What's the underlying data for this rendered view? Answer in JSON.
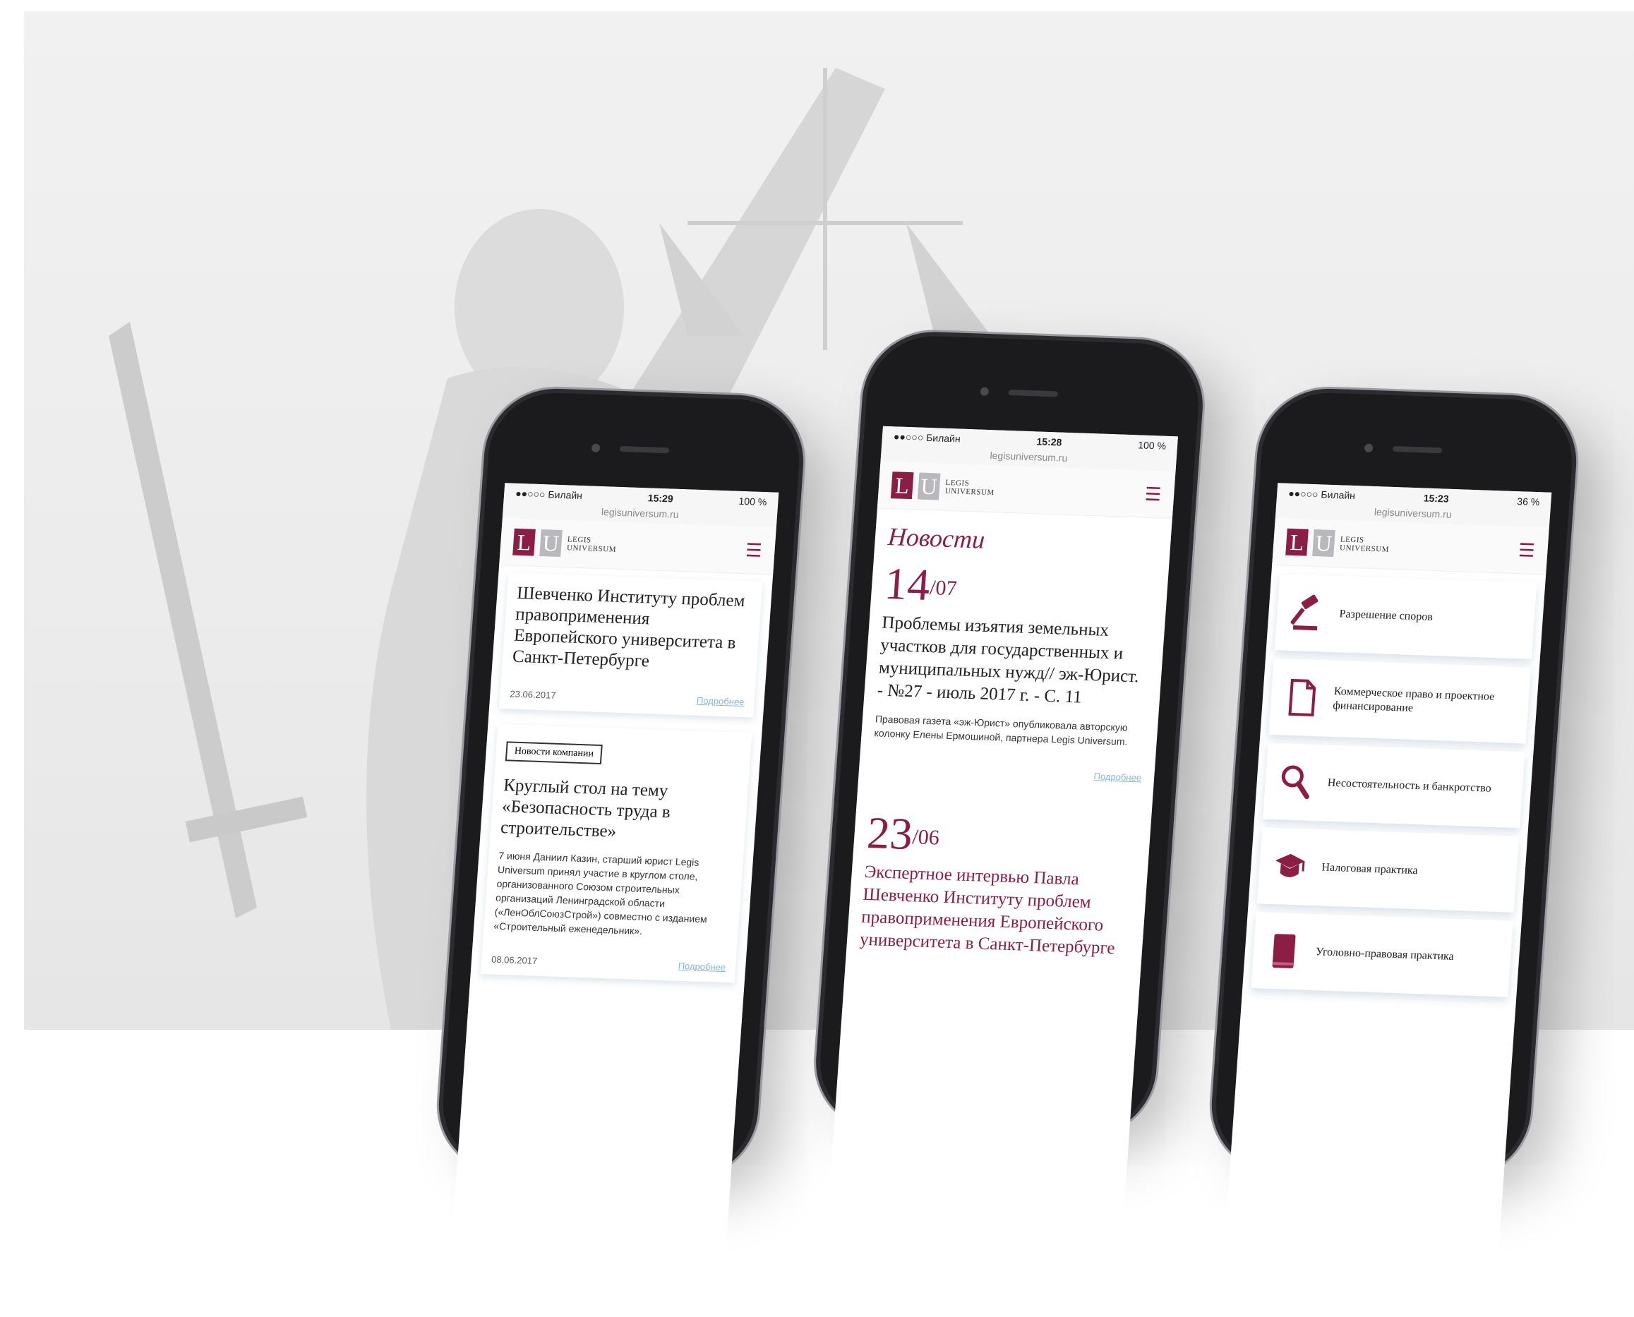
{
  "phone_left": {
    "status": {
      "carrier": "●●○○○ Билайн",
      "time": "15:29",
      "battery": "100 %"
    },
    "url": "legisuniversum.ru",
    "logo": {
      "letter1": "L",
      "letter2": "U",
      "name_line1": "LEGIS",
      "name_line2": "UNIVERSUM"
    },
    "card1": {
      "title": "Шевченко Институту проблем правоприменения Европейского университета в Санкт-Петербурге",
      "date": "23.06.2017",
      "more": "Подробнее"
    },
    "card2": {
      "tag": "Новости компании",
      "title": "Круглый стол на тему «Безопасность труда в строительстве»",
      "lead": "7 июня Даниил Казин, старший юрист Legis Universum принял участие в круглом столе, организованного Союзом строительных организаций Ленинградской области («ЛенОблСоюзСтрой») совместно с изданием «Строительный еженедельник».",
      "date": "08.06.2017",
      "more": "Подробнее"
    }
  },
  "phone_center": {
    "status": {
      "carrier": "●●○○○ Билайн",
      "time": "15:28",
      "battery": "100 %"
    },
    "url": "legisuniversum.ru",
    "logo": {
      "letter1": "L",
      "letter2": "U",
      "name_line1": "LEGIS",
      "name_line2": "UNIVERSUM"
    },
    "section": "Новости",
    "news1": {
      "day": "14",
      "month": "07",
      "title": "Проблемы изъятия земельных участков для государственных и муниципальных нужд// эж-Юрист. - №27 - июль 2017 г. - С. 11",
      "lead": "Правовая газета «эж-Юрист» опубликовала авторскую колонку Елены Ермошиной, партнера Legis Universum.",
      "more": "Подробнее"
    },
    "news2": {
      "day": "23",
      "month": "06",
      "title": "Экспертное интервью Павла Шевченко Институту проблем правоприменения Европейского университета в Санкт-Петербурге"
    }
  },
  "phone_right": {
    "status": {
      "carrier": "●●○○○ Билайн",
      "time": "15:23",
      "battery": "36 %"
    },
    "url": "legisuniversum.ru",
    "logo": {
      "letter1": "L",
      "letter2": "U",
      "name_line1": "LEGIS",
      "name_line2": "UNIVERSUM"
    },
    "practices": [
      {
        "icon": "gavel-icon",
        "label": "Разрешение споров"
      },
      {
        "icon": "document-icon",
        "label": "Коммерческое право и проектное финансирование"
      },
      {
        "icon": "magnifier-icon",
        "label": "Несостоятельность и банкротство"
      },
      {
        "icon": "graduation-cap-icon",
        "label": "Налоговая практика"
      },
      {
        "icon": "book-icon",
        "label": "Уголовно-правовая практика"
      }
    ]
  },
  "colors": {
    "brand": "#8c1d44",
    "link": "#8ab4d4"
  }
}
